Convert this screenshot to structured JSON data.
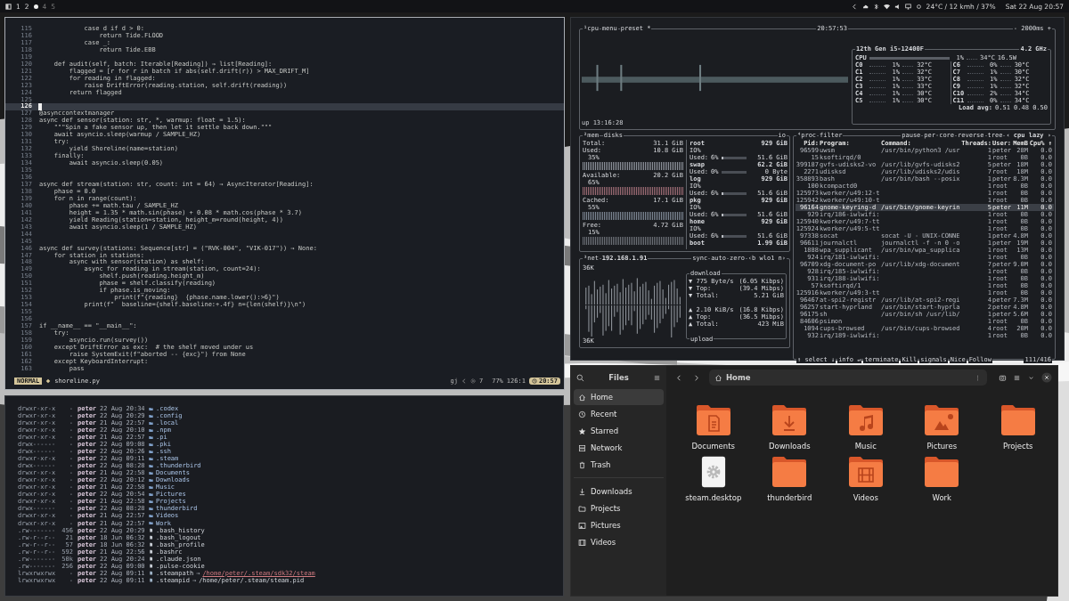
{
  "top_bar": {
    "workspaces": [
      {
        "label": "1",
        "selected": false,
        "occupied": true
      },
      {
        "label": "2",
        "selected": false,
        "occupied": true
      },
      {
        "selected": true,
        "occupied": true
      },
      {
        "label": "4",
        "selected": false,
        "occupied": false
      },
      {
        "label": "5",
        "selected": false,
        "occupied": false
      }
    ],
    "weather": "24°C / 12 kmh / 37%",
    "clock": "Sat 22 Aug 20:57"
  },
  "editor": {
    "lines": [
      {
        "number": "115",
        "text": "            case d if d > 0:",
        "current": false
      },
      {
        "number": "116",
        "text": "                return Tide.FLOOD",
        "current": false
      },
      {
        "number": "117",
        "text": "            case _:",
        "current": false
      },
      {
        "number": "118",
        "text": "                return Tide.EBB",
        "current": false
      },
      {
        "number": "119",
        "current": false
      },
      {
        "number": "120",
        "text": "    def audit(self, batch: Iterable[Reading]) → list[Reading]:",
        "current": false
      },
      {
        "number": "121",
        "text": "        flagged = [r for r in batch if abs(self.drift(r)) > MAX_DRIFT_M]",
        "current": false
      },
      {
        "number": "122",
        "text": "        for reading in flagged:",
        "current": false
      },
      {
        "number": "123",
        "text": "            raise DriftError(reading.station, self.drift(reading))",
        "current": false
      },
      {
        "number": "124",
        "text": "        return flagged",
        "current": false
      },
      {
        "number": "125",
        "current": false
      },
      {
        "number": "126",
        "current": true
      },
      {
        "number": "127",
        "text": "@asynccontextmanager",
        "current": false
      },
      {
        "number": "128",
        "text": "async def sensor(station: str, *, warmup: float = 1.5):",
        "current": false
      },
      {
        "number": "129",
        "text": "    \"\"\"Spin a fake sensor up, then let it settle back down.\"\"\"",
        "current": false
      },
      {
        "number": "130",
        "text": "    await asyncio.sleep(warmup / SAMPLE_HZ)",
        "current": false
      },
      {
        "number": "131",
        "text": "    try:",
        "current": false
      },
      {
        "number": "132",
        "text": "        yield Shoreline(name=station)",
        "current": false
      },
      {
        "number": "133",
        "text": "    finally:",
        "current": false
      },
      {
        "number": "134",
        "text": "        await asyncio.sleep(0.05)",
        "current": false
      },
      {
        "number": "135",
        "current": false
      },
      {
        "number": "136",
        "current": false
      },
      {
        "number": "137",
        "text": "async def stream(station: str, count: int = 64) → AsyncIterator[Reading]:",
        "current": false
      },
      {
        "number": "138",
        "text": "    phase = 0.0",
        "current": false
      },
      {
        "number": "139",
        "text": "    for n in range(count):",
        "current": false
      },
      {
        "number": "140",
        "text": "        phase += math.tau / SAMPLE_HZ",
        "current": false
      },
      {
        "number": "141",
        "text": "        height = 1.35 * math.sin(phase) + 0.08 * math.cos(phase * 3.7)",
        "current": false
      },
      {
        "number": "142",
        "text": "        yield Reading(station=station, height_m=round(height, 4))",
        "current": false
      },
      {
        "number": "143",
        "text": "        await asyncio.sleep(1 / SAMPLE_HZ)",
        "current": false
      },
      {
        "number": "144",
        "current": false
      },
      {
        "number": "145",
        "current": false
      },
      {
        "number": "146",
        "text": "async def survey(stations: Sequence[str] = (\"RVK-004\", \"VIK-017\")) → None:",
        "current": false
      },
      {
        "number": "147",
        "text": "    for station in stations:",
        "current": false
      },
      {
        "number": "148",
        "text": "        async with sensor(station) as shelf:",
        "current": false
      },
      {
        "number": "149",
        "text": "            async for reading in stream(station, count=24):",
        "current": false
      },
      {
        "number": "150",
        "text": "                shelf.push(reading.height_m)",
        "current": false
      },
      {
        "number": "151",
        "text": "                phase = shelf.classify(reading)",
        "current": false
      },
      {
        "number": "152",
        "text": "                if phase.is_moving:",
        "current": false
      },
      {
        "number": "153",
        "text": "                    print(f\"{reading}  {phase.name.lower():>6}\")",
        "current": false
      },
      {
        "number": "154",
        "text": "            print(f\"  baseline={shelf.baseline:+.4f} n={len(shelf)}\\n\")",
        "current": false
      },
      {
        "number": "155",
        "current": false
      },
      {
        "number": "156",
        "current": false
      },
      {
        "number": "157",
        "text": "if __name__ == \"__main__\":",
        "current": false
      },
      {
        "number": "158",
        "text": "    try:",
        "current": false
      },
      {
        "number": "159",
        "text": "        asyncio.run(survey())",
        "current": false
      },
      {
        "number": "160",
        "text": "    except DriftError as exc:  # the shelf moved under us",
        "current": false
      },
      {
        "number": "161",
        "text": "        raise SystemExit(f\"aborted -- {exc}\") from None",
        "current": false
      },
      {
        "number": "162",
        "text": "    except KeyboardInterrupt:",
        "current": false
      },
      {
        "number": "163",
        "text": "        pass",
        "current": false
      }
    ],
    "status": {
      "mode": "NORMAL",
      "file": "shoreline.py",
      "indicator": "gj",
      "diagnostics": "7",
      "progress": "77%",
      "position": "126:1",
      "time": "20:57"
    }
  },
  "terminal": {
    "entries": [
      {
        "permissions": "drwxr-xr-x",
        "size": "-",
        "user": "peter",
        "date": "22 Aug 20:34",
        "kind": "directory",
        "name": ".codex"
      },
      {
        "permissions": "drwxr-xr-x",
        "size": "-",
        "user": "peter",
        "date": "22 Aug 20:29",
        "kind": "directory",
        "name": ".config"
      },
      {
        "permissions": "drwxr-xr-x",
        "size": "-",
        "user": "peter",
        "date": "21 Aug 22:57",
        "kind": "directory",
        "name": ".local"
      },
      {
        "permissions": "drwxr-xr-x",
        "size": "-",
        "user": "peter",
        "date": "22 Aug 20:10",
        "kind": "directory",
        "name": ".npm"
      },
      {
        "permissions": "drwxr-xr-x",
        "size": "-",
        "user": "peter",
        "date": "21 Aug 22:57",
        "kind": "directory",
        "name": ".pi"
      },
      {
        "permissions": "drwx------",
        "size": "-",
        "user": "peter",
        "date": "22 Aug 09:08",
        "kind": "directory",
        "name": ".pki"
      },
      {
        "permissions": "drwx------",
        "size": "-",
        "user": "peter",
        "date": "22 Aug 20:26",
        "kind": "directory",
        "name": ".ssh"
      },
      {
        "permissions": "drwxr-xr-x",
        "size": "-",
        "user": "peter",
        "date": "22 Aug 09:11",
        "kind": "directory",
        "name": ".steam"
      },
      {
        "permissions": "drwx------",
        "size": "-",
        "user": "peter",
        "date": "22 Aug 08:28",
        "kind": "directory",
        "name": ".thunderbird"
      },
      {
        "permissions": "drwxr-xr-x",
        "size": "-",
        "user": "peter",
        "date": "21 Aug 22:58",
        "kind": "directory",
        "name": "Documents"
      },
      {
        "permissions": "drwxr-xr-x",
        "size": "-",
        "user": "peter",
        "date": "22 Aug 20:12",
        "kind": "directory",
        "name": "Downloads"
      },
      {
        "permissions": "drwxr-xr-x",
        "size": "-",
        "user": "peter",
        "date": "21 Aug 22:58",
        "kind": "directory",
        "name": "Music"
      },
      {
        "permissions": "drwxr-xr-x",
        "size": "-",
        "user": "peter",
        "date": "22 Aug 20:54",
        "kind": "directory",
        "name": "Pictures"
      },
      {
        "permissions": "drwxr-xr-x",
        "size": "-",
        "user": "peter",
        "date": "21 Aug 22:58",
        "kind": "directory",
        "name": "Projects"
      },
      {
        "permissions": "drwx------",
        "size": "-",
        "user": "peter",
        "date": "22 Aug 08:28",
        "kind": "directory",
        "name": "thunderbird"
      },
      {
        "permissions": "drwxr-xr-x",
        "size": "-",
        "user": "peter",
        "date": "21 Aug 22:57",
        "kind": "directory",
        "name": "Videos"
      },
      {
        "permissions": "drwxr-xr-x",
        "size": "-",
        "user": "peter",
        "date": "21 Aug 22:57",
        "kind": "directory",
        "name": "Work"
      },
      {
        "permissions": ".rw-------",
        "size": "456",
        "user": "peter",
        "date": "22 Aug 20:29",
        "kind": "file",
        "name": ".bash_history"
      },
      {
        "permissions": ".rw-r--r--",
        "size": "21",
        "user": "peter",
        "date": "18 Jun 06:32",
        "kind": "file",
        "name": ".bash_logout"
      },
      {
        "permissions": ".rw-r--r--",
        "size": "57",
        "user": "peter",
        "date": "18 Jun 06:32",
        "kind": "file",
        "name": ".bash_profile"
      },
      {
        "permissions": ".rw-r--r--",
        "size": "592",
        "user": "peter",
        "date": "21 Aug 22:56",
        "kind": "file",
        "name": ".bashrc"
      },
      {
        "permissions": ".rw-------",
        "size": "50k",
        "user": "peter",
        "date": "22 Aug 20:24",
        "kind": "file",
        "name": ".claude.json"
      },
      {
        "permissions": ".rw-------",
        "size": "256",
        "user": "peter",
        "date": "22 Aug 09:00",
        "kind": "file",
        "name": ".pulse-cookie"
      },
      {
        "permissions": "lrwxrwxrwx",
        "size": "-",
        "user": "peter",
        "date": "22 Aug 09:11",
        "kind": "link",
        "name": ".steampath",
        "arrow": "→",
        "target": "/home/peter/.steam/sdk32/steam",
        "broken": true
      },
      {
        "permissions": "lrwxrwxrwx",
        "size": "-",
        "user": "peter",
        "date": "22 Aug 09:11",
        "kind": "link",
        "name": ".steampid",
        "arrow": "→",
        "target": "/home/peter/.steam/steam.pid",
        "broken": false
      }
    ]
  },
  "monitor": {
    "cpu": {
      "title": "¹cpu",
      "menu": "menu",
      "preset": "preset *",
      "clock": "20:57:53",
      "interval": "- 2000ms +",
      "uptime": "up 13:16:28",
      "model": "12th Gen i5-12400F",
      "frequency": "4.2 GHz",
      "total": {
        "label": "CPU",
        "percent": "1%",
        "temp": "34°C",
        "power": "16.5W"
      },
      "cores": [
        {
          "name": "C0",
          "percent": "1%",
          "temp": "32°C"
        },
        {
          "name": "C1",
          "percent": "1%",
          "temp": "32°C"
        },
        {
          "name": "C2",
          "percent": "1%",
          "temp": "33°C"
        },
        {
          "name": "C3",
          "percent": "1%",
          "temp": "33°C"
        },
        {
          "name": "C4",
          "percent": "1%",
          "temp": "30°C"
        },
        {
          "name": "C5",
          "percent": "1%",
          "temp": "30°C"
        },
        {
          "name": "C6",
          "percent": "0%",
          "temp": "30°C"
        },
        {
          "name": "C7",
          "percent": "1%",
          "temp": "30°C"
        },
        {
          "name": "C8",
          "percent": "1%",
          "temp": "32°C"
        },
        {
          "name": "C9",
          "percent": "1%",
          "temp": "32°C"
        },
        {
          "name": "C10",
          "percent": "2%",
          "temp": "34°C"
        },
        {
          "name": "C11",
          "percent": "0%",
          "temp": "34°C"
        }
      ],
      "load_label": "Load avg:",
      "load": "0.51 0.48 0.50"
    },
    "mem": {
      "title": "²mem",
      "rows": [
        {
          "label": "Total:",
          "value": "31.1 GiB"
        },
        {
          "label": "Used:",
          "value": "10.8 GiB",
          "percent": "35%",
          "color": "#8d929b"
        },
        {
          "label": "Available:",
          "value": "20.2 GiB",
          "percent": "65%",
          "color": "#9c6b74"
        },
        {
          "label": "Cached:",
          "value": "17.1 GiB",
          "percent": "55%",
          "color": "#7d8794"
        },
        {
          "label": "Free:",
          "value": "4.72 GiB",
          "percent": "15%",
          "color": "#6c7077"
        }
      ]
    },
    "disks": {
      "title": "disks",
      "io": "io",
      "items": [
        {
          "name": "root",
          "size": "929 GiB",
          "io": "IO%",
          "used_label": "Used:",
          "used_percent": "6%",
          "level": 0.06,
          "used": "51.6 GiB"
        },
        {
          "name": "swap",
          "size": "62.2 GiB",
          "used_label": "Used:",
          "used_percent": "0%",
          "level": 0,
          "used": "0 Byte"
        },
        {
          "name": "log",
          "size": "929 GiB",
          "io": "IO%",
          "used_label": "Used:",
          "used_percent": "6%",
          "level": 0.06,
          "used": "51.6 GiB"
        },
        {
          "name": "pkg",
          "size": "929 GiB",
          "io": "IO%",
          "used_label": "Used:",
          "used_percent": "6%",
          "level": 0.06,
          "used": "51.6 GiB"
        },
        {
          "name": "home",
          "size": "929 GiB",
          "io": "IO%",
          "used_label": "Used:",
          "used_percent": "6%",
          "level": 0.06,
          "used": "51.6 GiB"
        },
        {
          "name": "boot",
          "size": "1.99 GiB"
        }
      ]
    },
    "net": {
      "title": "³net",
      "address": "192.168.1.91",
      "buttons": [
        "sync",
        "auto",
        "zero",
        "‹b wlo1 n›"
      ],
      "scale_top": "36K",
      "scale_bottom": "36K",
      "download_title": "download",
      "upload_title": "upload",
      "download": [
        {
          "arrow": "▼",
          "label": "775 Byte/s",
          "value": "(6.05 Kibps)"
        },
        {
          "arrow": "▼",
          "label": "Top:",
          "value": "(39.4 Mibps)"
        },
        {
          "arrow": "▼",
          "label": "Total:",
          "value": "5.21 GiB"
        }
      ],
      "upload": [
        {
          "arrow": "▲",
          "label": "2.10 KiB/s",
          "value": "(16.8 Kibps)"
        },
        {
          "arrow": "▲",
          "label": "Top:",
          "value": "(36.5 Mibps)"
        },
        {
          "arrow": "▲",
          "label": "Total:",
          "value": "423 MiB"
        }
      ]
    },
    "proc": {
      "title": "⁴proc",
      "filter": "filter",
      "options": [
        "pause",
        "per-core",
        "reverse",
        "tree"
      ],
      "sort": "‹ cpu lazy ›",
      "columns": [
        "Pid:",
        "Program:",
        "Command:",
        "Threads:",
        "User:",
        "MemB",
        "Cpu% ↑"
      ],
      "rows": [
        {
          "pid": "96599",
          "program": "uwsm",
          "command": "/usr/bin/python3 /usr",
          "threads": "1",
          "user": "peter",
          "mem": "28M",
          "cpu": "0.0",
          "selected": false
        },
        {
          "pid": "15",
          "program": "ksoftirqd/0",
          "threads": "1",
          "user": "root",
          "mem": "0B",
          "cpu": "0.0",
          "selected": false
        },
        {
          "pid": "399187",
          "program": "gvfs-udisks2-vo",
          "command": "/usr/lib/gvfs-udisks2",
          "threads": "5",
          "user": "peter",
          "mem": "18M",
          "cpu": "0.0",
          "selected": false
        },
        {
          "pid": "2271",
          "program": "udisksd",
          "command": "/usr/lib/udisks2/udis",
          "threads": "7",
          "user": "root",
          "mem": "18M",
          "cpu": "0.0",
          "selected": false
        },
        {
          "pid": "358893",
          "program": "bash",
          "command": "/usr/bin/bash --posix",
          "threads": "1",
          "user": "peter",
          "mem": "8.3M",
          "cpu": "0.0",
          "selected": false
        },
        {
          "pid": "100",
          "program": "kcompactd0",
          "threads": "1",
          "user": "root",
          "mem": "0B",
          "cpu": "0.0",
          "selected": false
        },
        {
          "pid": "125973",
          "program": "kworker/u49:12-t",
          "threads": "1",
          "user": "root",
          "mem": "0B",
          "cpu": "0.0",
          "selected": false
        },
        {
          "pid": "125942",
          "program": "kworker/u49:10-t",
          "threads": "1",
          "user": "root",
          "mem": "0B",
          "cpu": "0.0",
          "selected": false
        },
        {
          "pid": "96164",
          "program": "gnome-keyring-d",
          "command": "/usr/bin/gnome-keyrin",
          "threads": "5",
          "user": "peter",
          "mem": "11M",
          "cpu": "0.0",
          "selected": true
        },
        {
          "pid": "929",
          "program": "irq/186-iwlwifi:",
          "threads": "1",
          "user": "root",
          "mem": "0B",
          "cpu": "0.0",
          "selected": false
        },
        {
          "pid": "125940",
          "program": "kworker/u49:7-tt",
          "threads": "1",
          "user": "root",
          "mem": "0B",
          "cpu": "0.0",
          "selected": false
        },
        {
          "pid": "125924",
          "program": "kworker/u49:5-tt",
          "threads": "1",
          "user": "root",
          "mem": "0B",
          "cpu": "0.0",
          "selected": false
        },
        {
          "pid": "97338",
          "program": "socat",
          "command": "socat -U - UNIX-CONNE",
          "threads": "1",
          "user": "peter",
          "mem": "4.8M",
          "cpu": "0.0",
          "selected": false
        },
        {
          "pid": "96611",
          "program": "journalctl",
          "command": "journalctl -f -n 0 -o",
          "threads": "1",
          "user": "peter",
          "mem": "19M",
          "cpu": "0.0",
          "selected": false
        },
        {
          "pid": "1888",
          "program": "wpa_supplicant",
          "command": "/usr/bin/wpa_supplica",
          "threads": "1",
          "user": "root",
          "mem": "13M",
          "cpu": "0.0",
          "selected": false
        },
        {
          "pid": "924",
          "program": "irq/181-iwlwifi:",
          "threads": "1",
          "user": "root",
          "mem": "0B",
          "cpu": "0.0",
          "selected": false
        },
        {
          "pid": "96709",
          "program": "xdg-document-po",
          "command": "/usr/lib/xdg-document",
          "threads": "7",
          "user": "peter",
          "mem": "9.0M",
          "cpu": "0.0",
          "selected": false
        },
        {
          "pid": "928",
          "program": "irq/185-iwlwifi:",
          "threads": "1",
          "user": "root",
          "mem": "0B",
          "cpu": "0.0",
          "selected": false
        },
        {
          "pid": "931",
          "program": "irq/188-iwlwifi:",
          "threads": "1",
          "user": "root",
          "mem": "0B",
          "cpu": "0.0",
          "selected": false
        },
        {
          "pid": "57",
          "program": "ksoftirqd/1",
          "threads": "1",
          "user": "root",
          "mem": "0B",
          "cpu": "0.0",
          "selected": false
        },
        {
          "pid": "125916",
          "program": "kworker/u49:3-tt",
          "threads": "1",
          "user": "root",
          "mem": "0B",
          "cpu": "0.0",
          "selected": false
        },
        {
          "pid": "96467",
          "program": "at-spi2-registr",
          "command": "/usr/lib/at-spi2-regi",
          "threads": "4",
          "user": "peter",
          "mem": "7.3M",
          "cpu": "0.0",
          "selected": false
        },
        {
          "pid": "96257",
          "program": "start-hyprland",
          "command": "/usr/bin/start-hyprla",
          "threads": "2",
          "user": "peter",
          "mem": "4.8M",
          "cpu": "0.0",
          "selected": false
        },
        {
          "pid": "96175",
          "program": "sh",
          "command": "/usr/bin/sh /usr/lib/",
          "threads": "1",
          "user": "peter",
          "mem": "5.6M",
          "cpu": "0.0",
          "selected": false
        },
        {
          "pid": "84606",
          "program": "psimon",
          "threads": "1",
          "user": "root",
          "mem": "0B",
          "cpu": "0.0",
          "selected": false
        },
        {
          "pid": "1094",
          "program": "cups-browsed",
          "command": "/usr/bin/cups-browsed",
          "threads": "4",
          "user": "root",
          "mem": "20M",
          "cpu": "0.0",
          "selected": false
        },
        {
          "pid": "932",
          "program": "irq/189-iwlwifi:",
          "threads": "1",
          "user": "root",
          "mem": "0B",
          "cpu": "0.0",
          "selected": false
        }
      ],
      "footer": [
        "↑ select ↓",
        "info ↵",
        "terminate",
        "Kill",
        "signals",
        "Nice",
        "Follow"
      ],
      "count": "111/416"
    }
  },
  "files": {
    "title": "Files",
    "path": "Home",
    "places": [
      {
        "label": "Home",
        "selected": true
      },
      {
        "label": "Recent",
        "selected": false
      },
      {
        "label": "Starred",
        "selected": false
      },
      {
        "label": "Network",
        "selected": false
      },
      {
        "label": "Trash",
        "selected": false
      }
    ],
    "bookmarks": [
      {
        "label": "Downloads",
        "selected": false
      },
      {
        "label": "Projects",
        "selected": false
      },
      {
        "label": "Pictures",
        "selected": false
      },
      {
        "label": "Videos",
        "selected": false
      }
    ],
    "items": [
      {
        "name": "Documents",
        "kind": "folder"
      },
      {
        "name": "Downloads",
        "kind": "folder"
      },
      {
        "name": "Music",
        "kind": "folder"
      },
      {
        "name": "Pictures",
        "kind": "folder"
      },
      {
        "name": "Projects",
        "kind": "folder"
      },
      {
        "name": "steam.desktop",
        "kind": "file"
      },
      {
        "name": "thunderbird",
        "kind": "folder"
      },
      {
        "name": "Videos",
        "kind": "folder"
      },
      {
        "name": "Work",
        "kind": "folder"
      }
    ]
  }
}
